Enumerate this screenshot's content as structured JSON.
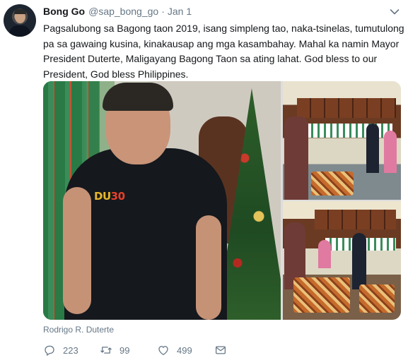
{
  "tweet": {
    "author_name": "Bong Go",
    "author_handle": "@sap_bong_go",
    "separator": "·",
    "date": "Jan 1",
    "text_lines": [
      "Pagsalubong sa Bagong taon 2019, isang simpleng tao, naka-tsinelas, tumutulong",
      "pa sa gawaing kusina, kinakausap ang mga kasambahay. Mahal ka namin Mayor",
      "President Duterte, Maligayang Bagong Taon sa ating lahat. God bless to our",
      "President, God bless Philippines."
    ],
    "media_credit": "Rodrigo R. Duterte",
    "media_shirt_text_a": "DU",
    "media_shirt_text_b": "30"
  },
  "actions": {
    "reply_count": "223",
    "retweet_count": "99",
    "like_count": "499"
  },
  "icons": {
    "reply": "reply-icon",
    "retweet": "retweet-icon",
    "like": "heart-icon",
    "message": "envelope-icon",
    "caret": "chevron-down-icon"
  },
  "colors": {
    "text": "#14171a",
    "muted": "#657786"
  }
}
